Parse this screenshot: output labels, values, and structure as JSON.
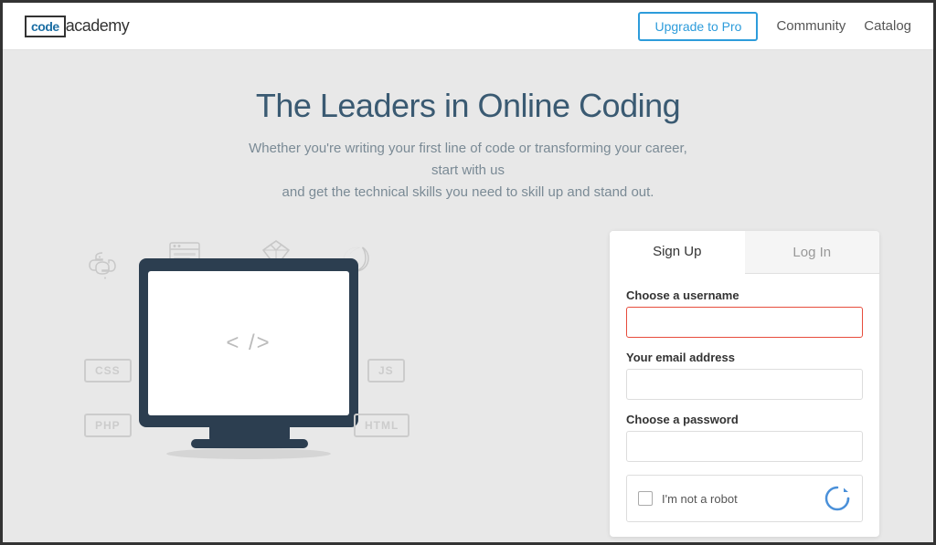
{
  "header": {
    "logo": {
      "code": "code",
      "academy": "academy"
    },
    "nav": {
      "upgrade_label": "Upgrade to Pro",
      "community_label": "Community",
      "catalog_label": "Catalog"
    }
  },
  "hero": {
    "title": "The Leaders in Online Coding",
    "subtitle_line1": "Whether you're writing your first line of code or transforming your career, start with us",
    "subtitle_line2": "and get the technical skills you need to skill up and stand out."
  },
  "illustration": {
    "monitor_code": "< />",
    "labels": [
      "CSS",
      "JS",
      "PHP",
      "HTML"
    ]
  },
  "signup_card": {
    "tabs": [
      {
        "label": "Sign Up",
        "active": true
      },
      {
        "label": "Log In",
        "active": false
      }
    ],
    "fields": [
      {
        "label": "Choose a username",
        "type": "text",
        "error": true
      },
      {
        "label": "Your email address",
        "type": "email",
        "error": false
      },
      {
        "label": "Choose a password",
        "type": "password",
        "error": false
      }
    ],
    "captcha_text": "I'm not a robot"
  }
}
